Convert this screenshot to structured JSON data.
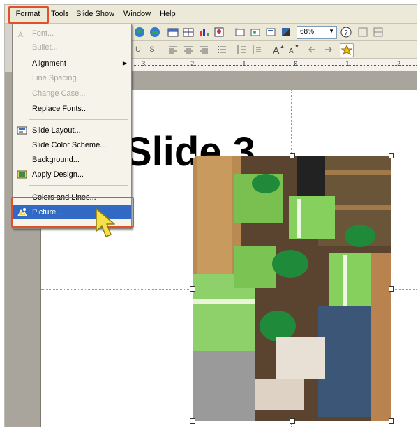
{
  "menubar": {
    "items": [
      {
        "label": "Format",
        "underline": "o"
      },
      {
        "label": "Tools",
        "underline": "T"
      },
      {
        "label": "Slide Show",
        "underline": "d"
      },
      {
        "label": "Window",
        "underline": "W"
      },
      {
        "label": "Help",
        "underline": "H"
      }
    ]
  },
  "toolbar": {
    "zoom": "68%",
    "bold_label": "U",
    "shadow_label": "S"
  },
  "ruler": {
    "ticks": [
      "3",
      "2",
      "1",
      "0",
      "1",
      "2"
    ]
  },
  "format_menu": {
    "items": [
      {
        "label": "Font...",
        "disabled": true,
        "icon": "font-icon"
      },
      {
        "label": "Bullet...",
        "disabled": true
      },
      {
        "label": "Alignment",
        "disabled": false,
        "submenu": true
      },
      {
        "label": "Line Spacing...",
        "disabled": true
      },
      {
        "label": "Change Case...",
        "disabled": true
      },
      {
        "label": "Replace Fonts...",
        "disabled": false
      },
      {
        "label": "Slide Layout...",
        "disabled": false,
        "icon": "slide-layout-icon"
      },
      {
        "label": "Slide Color Scheme...",
        "disabled": false
      },
      {
        "label": "Background...",
        "disabled": false
      },
      {
        "label": "Apply Design...",
        "disabled": false,
        "icon": "apply-design-icon"
      },
      {
        "label": "Colors and Lines...",
        "disabled": false
      },
      {
        "label": "Picture...",
        "disabled": false,
        "selected": true,
        "icon": "picture-icon"
      }
    ]
  },
  "slide": {
    "title": "Slide 3"
  },
  "colors": {
    "highlight": "#e0502a",
    "selection": "#316ac5",
    "menu_bg": "#f5f3ea",
    "chrome": "#ece9d8",
    "cursor": "#f4e04a"
  }
}
